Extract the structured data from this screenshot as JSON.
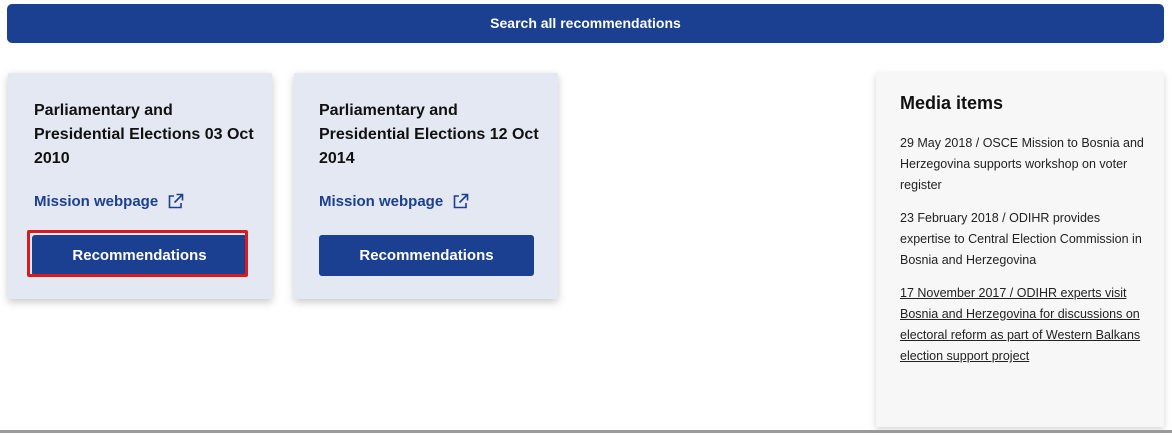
{
  "search": {
    "label": "Search all recommendations"
  },
  "cards": [
    {
      "title": "Parliamentary and Presidential Elections 03 Oct 2010",
      "mission_link": "Mission webpage",
      "button": "Recommendations",
      "highlighted": true
    },
    {
      "title": "Parliamentary and Presidential Elections 12 Oct 2014",
      "mission_link": "Mission webpage",
      "button": "Recommendations",
      "highlighted": false
    }
  ],
  "media": {
    "title": "Media items",
    "items": [
      {
        "text": "29 May 2018 / OSCE Mission to Bosnia and Herzegovina supports workshop on voter register",
        "link": false
      },
      {
        "text": "23 February 2018 / ODIHR provides expertise to Central Election Commission in Bosnia and Herzegovina",
        "link": false
      },
      {
        "text": "17 November 2017 / ODIHR experts visit Bosnia and Herzegovina for discussions on electoral reform as part of Western Balkans election support project",
        "link": true
      }
    ]
  },
  "colors": {
    "brand": "#1b3f91",
    "card_bg": "#e4e8f3",
    "highlight": "#d91b1b"
  },
  "icons": {
    "external_link": "external-link-icon"
  }
}
